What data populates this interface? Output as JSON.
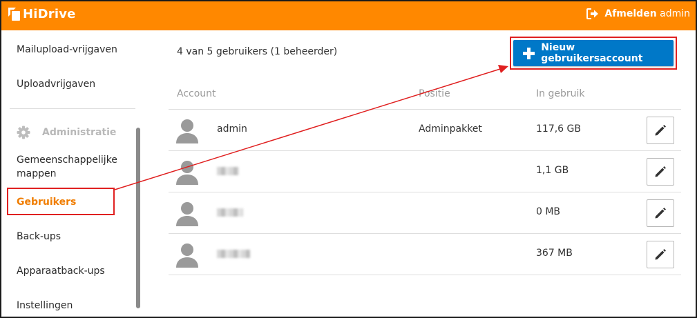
{
  "header": {
    "logo_text": "HiDrive",
    "logout_label": "Afmelden",
    "username": "admin"
  },
  "sidebar": {
    "items": [
      {
        "label": "Mailupload-vrijgaven"
      },
      {
        "label": "Uploadvrijgaven"
      }
    ],
    "section_title": "Administratie",
    "admin_items": [
      {
        "label": "Gemeenschappelijke mappen"
      },
      {
        "label": "Gebruikers",
        "active": true
      },
      {
        "label": "Back-ups"
      },
      {
        "label": "Apparaatback-ups"
      },
      {
        "label": "Instellingen"
      }
    ]
  },
  "main": {
    "user_count": "4 van 5 gebruikers (1 beheerder)",
    "new_button_label": "Nieuw gebruikersaccount",
    "columns": {
      "account": "Account",
      "position": "Positie",
      "usage": "In gebruik"
    },
    "rows": [
      {
        "account": "admin",
        "position": "Adminpakket",
        "usage": "117,6 GB",
        "blurred": false
      },
      {
        "account": "",
        "position": "",
        "usage": "1,1 GB",
        "blurred": true
      },
      {
        "account": "",
        "position": "",
        "usage": "0 MB",
        "blurred": true
      },
      {
        "account": "",
        "position": "",
        "usage": "367 MB",
        "blurred": true
      }
    ]
  },
  "colors": {
    "brand_orange": "#ff8800",
    "active_nav": "#f07d00",
    "primary_button": "#0078c8",
    "annotation_red": "#e02020"
  },
  "icons": [
    "logout-icon",
    "gear-icon",
    "plus-icon",
    "user-avatar-icon",
    "pencil-icon"
  ]
}
